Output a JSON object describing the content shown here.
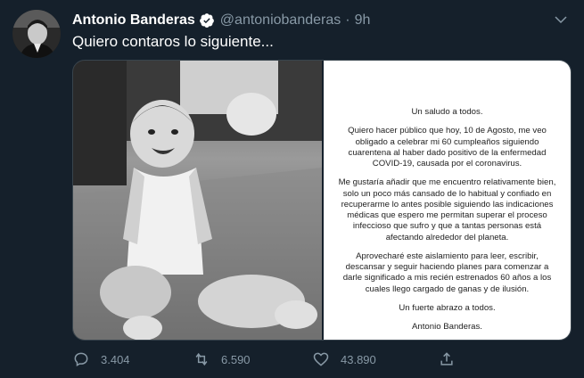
{
  "tweet": {
    "author_name": "Antonio Banderas",
    "handle": "@antoniobanderas",
    "separator": "·",
    "time": "9h",
    "text": "Quiero contaros lo siguiente..."
  },
  "letter": {
    "greeting": "Un saludo a todos.",
    "para1": "Quiero hacer público que hoy, 10 de Agosto, me veo obligado a celebrar mi 60 cumpleaños siguiendo cuarentena al haber dado positivo de la enfermedad COVID-19, causada por el coronavirus.",
    "para2": "Me gustaría añadir que me encuentro relativamente bien, solo un poco más cansado de lo habitual y confiado en recuperarme lo antes posible siguiendo las indicaciones médicas que espero me permitan superar el proceso infeccioso que sufro y que a tantas personas está afectando alrededor del planeta.",
    "para3": "Aprovecharé este aislamiento para leer, escribir, descansar y seguir haciendo planes para comenzar a darle significado a mis recién estrenados 60 años a los cuales llego cargado de ganas y de ilusión.",
    "closing": "Un fuerte abrazo a todos.",
    "signature": "Antonio Banderas."
  },
  "actions": {
    "replies": "3.404",
    "retweets": "6.590",
    "likes": "43.890"
  },
  "colors": {
    "background": "#15202b",
    "verified": "#ffffff",
    "muted": "#8899a6"
  }
}
